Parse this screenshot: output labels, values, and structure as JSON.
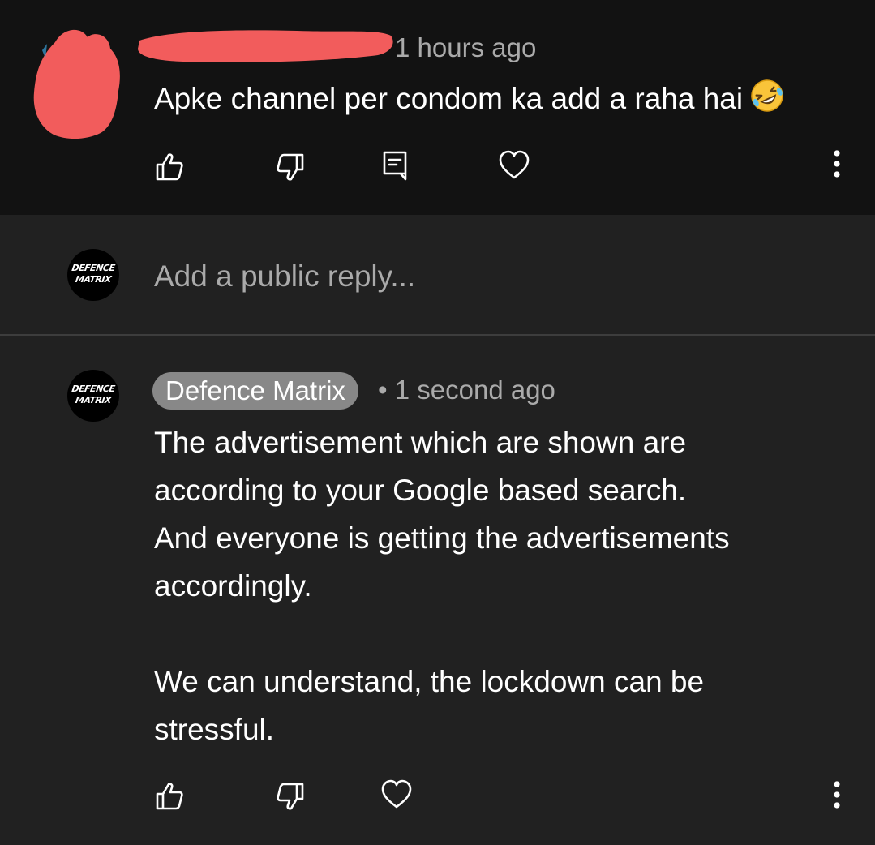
{
  "top_comment": {
    "timestamp": "1 hours ago",
    "text": "Apke channel per condom ka add a raha hai",
    "emoji": "rolling-on-floor-laughing"
  },
  "reply_box": {
    "placeholder": "Add a public reply...",
    "avatar_text_line1": "DEFENCE",
    "avatar_text_line2": "MATRIX"
  },
  "reply": {
    "author": "Defence Matrix",
    "separator": "•",
    "timestamp": "1 second ago",
    "paragraphs": [
      "The advertisement which are shown are\naccording to your Google based search.\nAnd everyone is getting the advertisements\naccordingly.",
      "We can understand, the lockdown can be\nstressful."
    ],
    "avatar_text_line1": "DEFENCE",
    "avatar_text_line2": "MATRIX"
  },
  "colors": {
    "page_bg": "#212121",
    "highlight_bg": "#121212",
    "secondary_text": "#aaaaaa",
    "chip_bg": "#888888",
    "redaction": "#f25c5c"
  }
}
